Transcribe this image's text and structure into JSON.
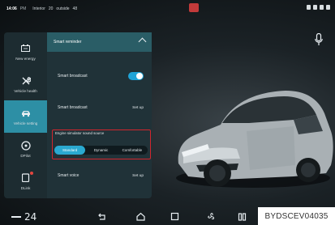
{
  "status_bar": {
    "time": "14:06",
    "am_pm": "PM",
    "interior_label": "Interior",
    "interior_temp": "20",
    "outside_label": "outside",
    "outside_temp": "48"
  },
  "nav": {
    "items": [
      {
        "label": "New energy",
        "icon": "battery-icon"
      },
      {
        "label": "Vehicle health",
        "icon": "wrench-icon"
      },
      {
        "label": "Vehicle setting",
        "icon": "car-icon",
        "active": true
      },
      {
        "label": "DPilot",
        "icon": "steering-wheel-icon"
      },
      {
        "label": "DLink",
        "icon": "phone-icon"
      }
    ]
  },
  "panel": {
    "header": "Smart reminder",
    "rows": [
      {
        "label": "Smart broadcast",
        "control": "toggle",
        "on": true
      },
      {
        "label": "Smart broadcast",
        "action": "Set up"
      },
      {
        "label": "Smart voice",
        "action": "Set up"
      }
    ],
    "engine_sound": {
      "title": "Engine simulator sound source",
      "options": [
        "Standard",
        "Dynamic",
        "Comfortable"
      ],
      "selected": "Standard"
    }
  },
  "dock": {
    "temperature": "24",
    "icons": [
      "back-icon",
      "home-icon",
      "recent-apps-icon",
      "fan-icon",
      "seat-icon",
      "climate-icon"
    ]
  },
  "watermark": "BYDSCEV04035",
  "colors": {
    "accent": "#2aa9d0",
    "nav_active": "#2d8fa5",
    "highlight_box": "#d2262d"
  }
}
